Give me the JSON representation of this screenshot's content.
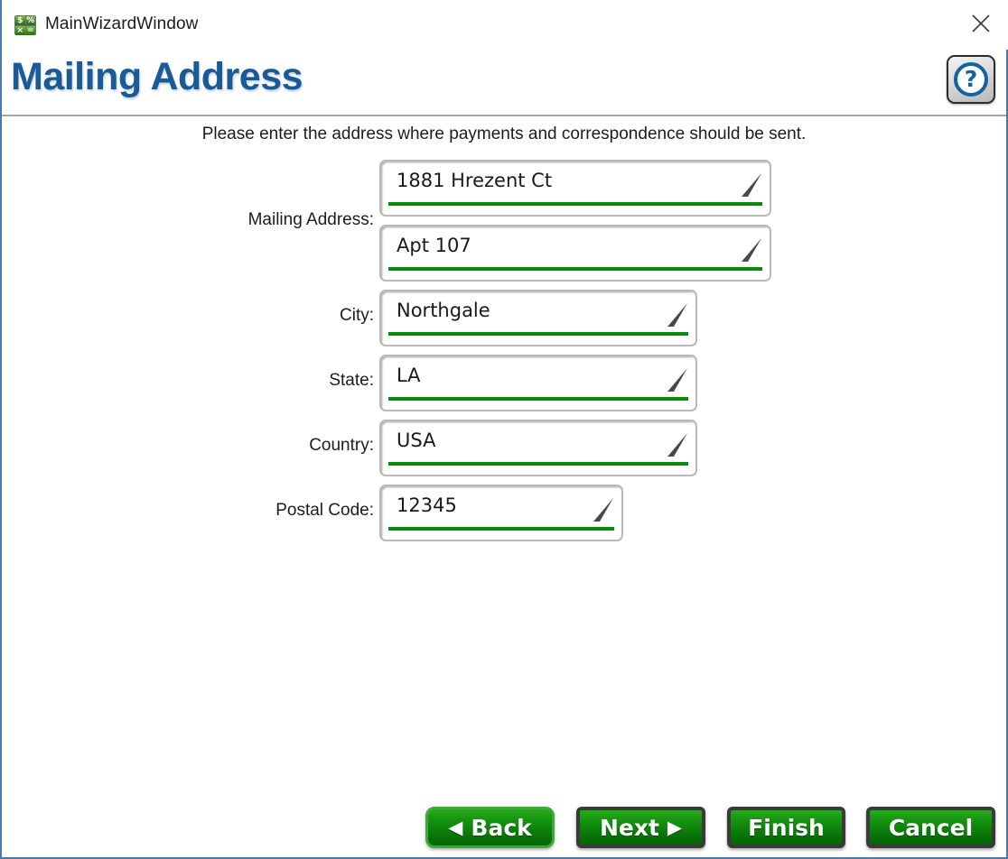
{
  "window": {
    "title": "MainWizardWindow",
    "app_icon": "calculator-icon",
    "app_icon_glyphs": [
      "$",
      "%",
      "×",
      "="
    ],
    "close_icon": "close-icon",
    "border_color": "#4a7aab"
  },
  "header": {
    "page_title": "Mailing Address",
    "title_color": "#1a5a96",
    "help_icon": "question-mark-icon",
    "help_symbol": "?"
  },
  "content": {
    "instruction": "Please enter the address where payments and correspondence should be sent.",
    "fields": [
      {
        "name": "mailing-address",
        "label": "Mailing Address:",
        "value": "1881 Hrezent Ct",
        "placeholder": ""
      },
      {
        "name": "mailing-address-line2",
        "label": "",
        "value": "Apt 107",
        "placeholder": ""
      },
      {
        "name": "city",
        "label": "City:",
        "value": "Northgale",
        "placeholder": ""
      },
      {
        "name": "state",
        "label": "State:",
        "value": "LA",
        "placeholder": ""
      },
      {
        "name": "country",
        "label": "Country:",
        "value": "USA",
        "placeholder": ""
      },
      {
        "name": "postal-code",
        "label": "Postal Code:",
        "value": "12345",
        "placeholder": ""
      }
    ],
    "field_accent_color": "#0a8a0a"
  },
  "buttons": {
    "back": {
      "label": "Back",
      "arrow": "◀"
    },
    "next": {
      "label": "Next",
      "arrow": "▶"
    },
    "finish": {
      "label": "Finish"
    },
    "cancel": {
      "label": "Cancel"
    },
    "color": "#0a7a08"
  }
}
